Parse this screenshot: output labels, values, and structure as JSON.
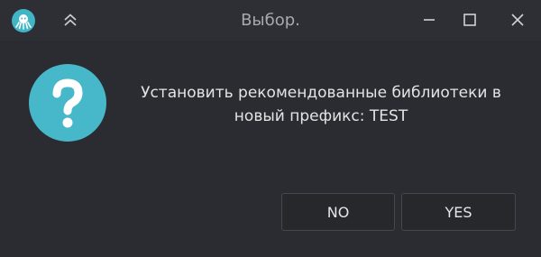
{
  "window": {
    "title": "Выбор.",
    "app_icon": "wine-octopus-icon",
    "controls": [
      "chevron-up-icon",
      "minimize-icon",
      "maximize-icon",
      "close-icon"
    ]
  },
  "dialog": {
    "icon": "question-icon",
    "message": "Установить рекомендованные библиотеки в\nновый префикс:   TEST",
    "buttons": {
      "no_label": "NO",
      "yes_label": "YES"
    }
  },
  "colors": {
    "background": "#2b2c31",
    "question_icon": "#46b8c9",
    "app_icon": "#3fb5c6",
    "text": "#e4e4e6",
    "title_text": "#a8a9ad",
    "button_border": "#46474d"
  }
}
